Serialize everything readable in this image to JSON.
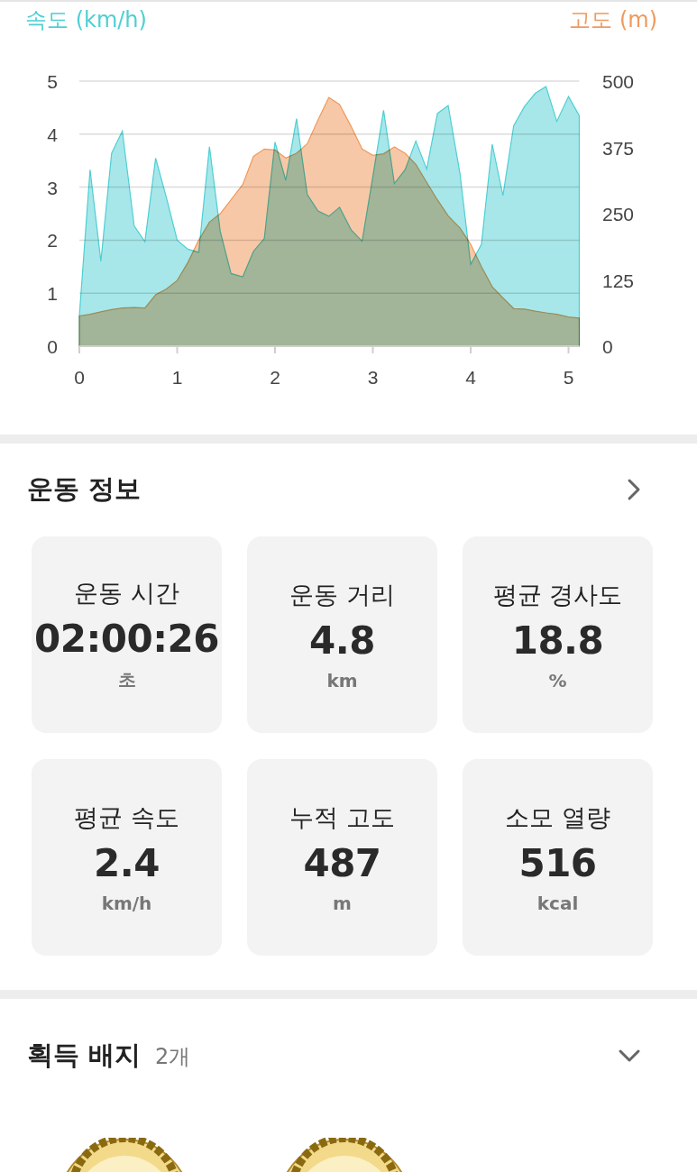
{
  "chart": {
    "chart_data": {
      "type": "area",
      "x": [
        0,
        0.11,
        0.22,
        0.33,
        0.44,
        0.56,
        0.67,
        0.78,
        0.89,
        1.0,
        1.11,
        1.22,
        1.33,
        1.44,
        1.55,
        1.67,
        1.78,
        1.89,
        2.0,
        2.11,
        2.22,
        2.33,
        2.44,
        2.55,
        2.66,
        2.78,
        2.89,
        3.0,
        3.11,
        3.22,
        3.33,
        3.44,
        3.55,
        3.66,
        3.77,
        3.89,
        4.0,
        4.11,
        4.22,
        4.33,
        4.44,
        4.55,
        4.66,
        4.77,
        4.88,
        5.0,
        5.11
      ],
      "series": [
        {
          "name": "속도 (km/h)",
          "color": "#4fcfd3",
          "values": [
            0.57,
            3.33,
            1.6,
            3.64,
            4.06,
            2.27,
            1.97,
            3.55,
            2.8,
            2.0,
            1.83,
            1.77,
            3.76,
            2.17,
            1.37,
            1.31,
            1.79,
            2.03,
            3.85,
            3.13,
            4.29,
            2.86,
            2.55,
            2.45,
            2.62,
            2.19,
            1.98,
            3.2,
            4.45,
            3.07,
            3.33,
            3.87,
            3.34,
            4.39,
            4.54,
            3.26,
            1.54,
            1.92,
            3.81,
            2.84,
            4.16,
            4.52,
            4.77,
            4.9,
            4.24,
            4.71,
            4.35
          ]
        },
        {
          "name": "고도 (m)",
          "color": "#f09a5e",
          "axis": "y2",
          "values": [
            57,
            60,
            65,
            69,
            72,
            73,
            72,
            97,
            108,
            124,
            158,
            200,
            234,
            250,
            276,
            305,
            358,
            372,
            370,
            355,
            364,
            382,
            427,
            469,
            456,
            414,
            372,
            360,
            363,
            376,
            364,
            343,
            309,
            276,
            246,
            223,
            192,
            150,
            112,
            91,
            71,
            70,
            66,
            63,
            60,
            55,
            53
          ]
        }
      ],
      "grid": true,
      "xlim": [
        0,
        5.11
      ],
      "xticks": [
        0,
        1,
        2,
        3,
        4,
        5
      ],
      "ylim": [
        0,
        5
      ],
      "yticks": [
        0,
        1,
        2,
        3,
        4,
        5
      ],
      "y2lim": [
        0,
        500
      ],
      "y2ticks": [
        0,
        125,
        250,
        375,
        500
      ]
    }
  },
  "exercise_info": {
    "title": "운동 정보",
    "stats": [
      {
        "label": "운동 시간",
        "value": "02:00:26",
        "unit": "초"
      },
      {
        "label": "운동 거리",
        "value": "4.8",
        "unit": "km"
      },
      {
        "label": "평균 경사도",
        "value": "18.8",
        "unit": "%"
      },
      {
        "label": "평균 속도",
        "value": "2.4",
        "unit": "km/h"
      },
      {
        "label": "누적 고도",
        "value": "487",
        "unit": "m"
      },
      {
        "label": "소모 열량",
        "value": "516",
        "unit": "kcal"
      }
    ]
  },
  "badges": {
    "title": "획득 배지",
    "count": "2개"
  }
}
